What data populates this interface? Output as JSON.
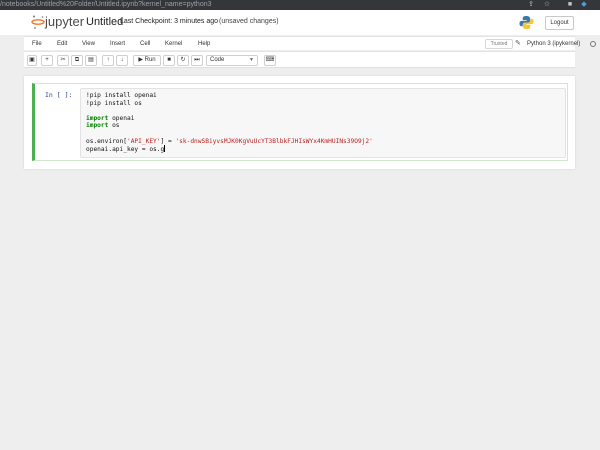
{
  "browser": {
    "url": "/notebooks/Untitled%20Folder/Untitled.ipynb?kernel_name=python3"
  },
  "header": {
    "logo_text": "jupyter",
    "notebook_title": "Untitled",
    "checkpoint": "Last Checkpoint: 3 minutes ago",
    "unsaved": "(unsaved changes)",
    "logout_label": "Logout"
  },
  "menu": {
    "items": [
      "File",
      "Edit",
      "View",
      "Insert",
      "Cell",
      "Kernel",
      "Help"
    ],
    "trusted_label": "Trusted",
    "kernel_name": "Python 3 (ipykernel)"
  },
  "toolbar": {
    "run_label": "Run",
    "cell_type": "Code"
  },
  "cell": {
    "prompt": "In [ ]:",
    "lines": {
      "l1": "!pip install openai",
      "l2": "!pip install os",
      "import_kw": "import",
      "mod_openai": " openai",
      "mod_os": " os",
      "environ_pre": "os.environ[",
      "env_key": "'API_KEY'",
      "environ_mid": "] = ",
      "env_val": "'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'",
      "last_line": "openai.api_key = os.g"
    }
  }
}
